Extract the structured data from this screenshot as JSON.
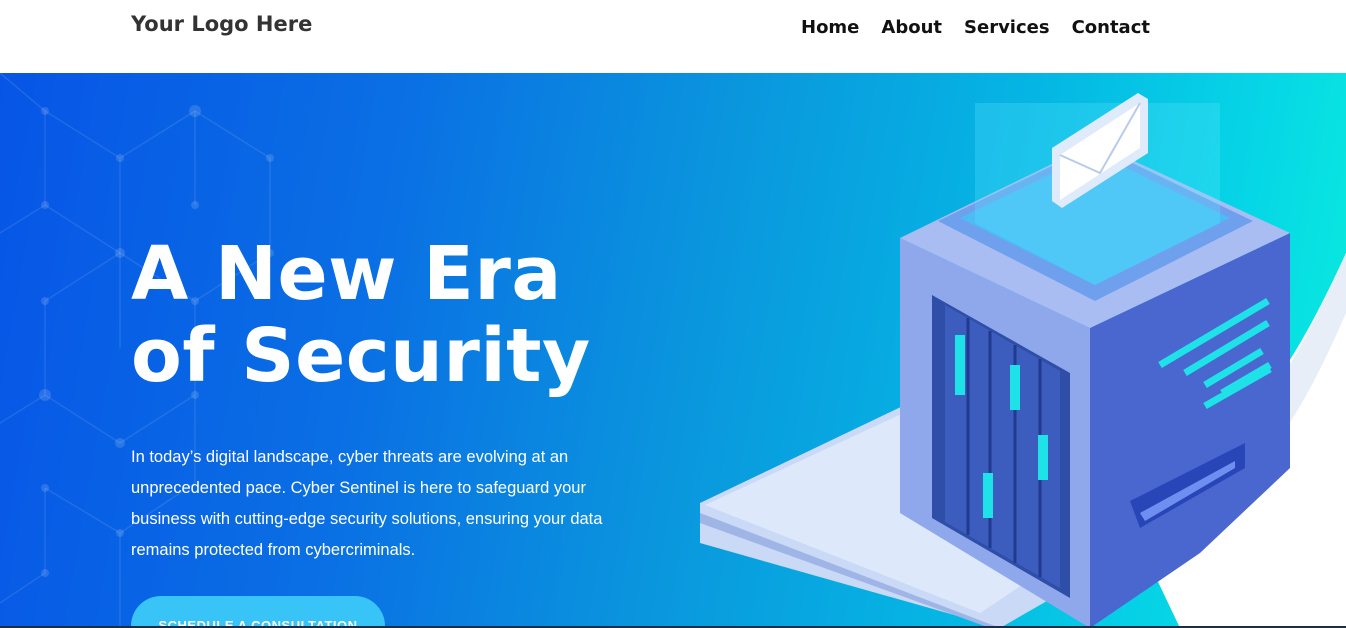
{
  "header": {
    "logo": "Your Logo Here",
    "nav": [
      "Home",
      "About",
      "Services",
      "Contact"
    ]
  },
  "hero": {
    "title_line1": "A New Era",
    "title_line2": "of Security",
    "description": "In today’s digital landscape, cyber threats are evolving at an unprecedented pace. Cyber Sentinel is here to safeguard your business with cutting-edge security solutions, ensuring your data remains protected from cybercriminals.",
    "cta_label": "SCHEDULE A CONSULTATION",
    "illustration": "isometric-server-with-envelope-illustration"
  },
  "colors": {
    "hero_gradient_start": "#0755e6",
    "hero_gradient_end": "#0af0dc",
    "cta_background": "#39c4f8",
    "logo_text": "#333333",
    "nav_text": "#111111"
  }
}
